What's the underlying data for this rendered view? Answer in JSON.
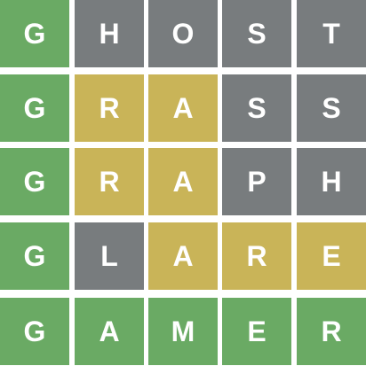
{
  "colors": {
    "correct": "#6aaa64",
    "present": "#c9b458",
    "absent": "#787c7e",
    "text": "#ffffff"
  },
  "board": {
    "rows": [
      {
        "guess": "GHOST",
        "tiles": [
          {
            "letter": "G",
            "state": "correct"
          },
          {
            "letter": "H",
            "state": "absent"
          },
          {
            "letter": "O",
            "state": "absent"
          },
          {
            "letter": "S",
            "state": "absent"
          },
          {
            "letter": "T",
            "state": "absent"
          }
        ]
      },
      {
        "guess": "GRASS",
        "tiles": [
          {
            "letter": "G",
            "state": "correct"
          },
          {
            "letter": "R",
            "state": "present"
          },
          {
            "letter": "A",
            "state": "present"
          },
          {
            "letter": "S",
            "state": "absent"
          },
          {
            "letter": "S",
            "state": "absent"
          }
        ]
      },
      {
        "guess": "GRAPH",
        "tiles": [
          {
            "letter": "G",
            "state": "correct"
          },
          {
            "letter": "R",
            "state": "present"
          },
          {
            "letter": "A",
            "state": "present"
          },
          {
            "letter": "P",
            "state": "absent"
          },
          {
            "letter": "H",
            "state": "absent"
          }
        ]
      },
      {
        "guess": "GLARE",
        "tiles": [
          {
            "letter": "G",
            "state": "correct"
          },
          {
            "letter": "L",
            "state": "absent"
          },
          {
            "letter": "A",
            "state": "present"
          },
          {
            "letter": "R",
            "state": "present"
          },
          {
            "letter": "E",
            "state": "present"
          }
        ]
      },
      {
        "guess": "GAMER",
        "tiles": [
          {
            "letter": "G",
            "state": "correct"
          },
          {
            "letter": "A",
            "state": "correct"
          },
          {
            "letter": "M",
            "state": "correct"
          },
          {
            "letter": "E",
            "state": "correct"
          },
          {
            "letter": "R",
            "state": "correct"
          }
        ]
      }
    ]
  }
}
